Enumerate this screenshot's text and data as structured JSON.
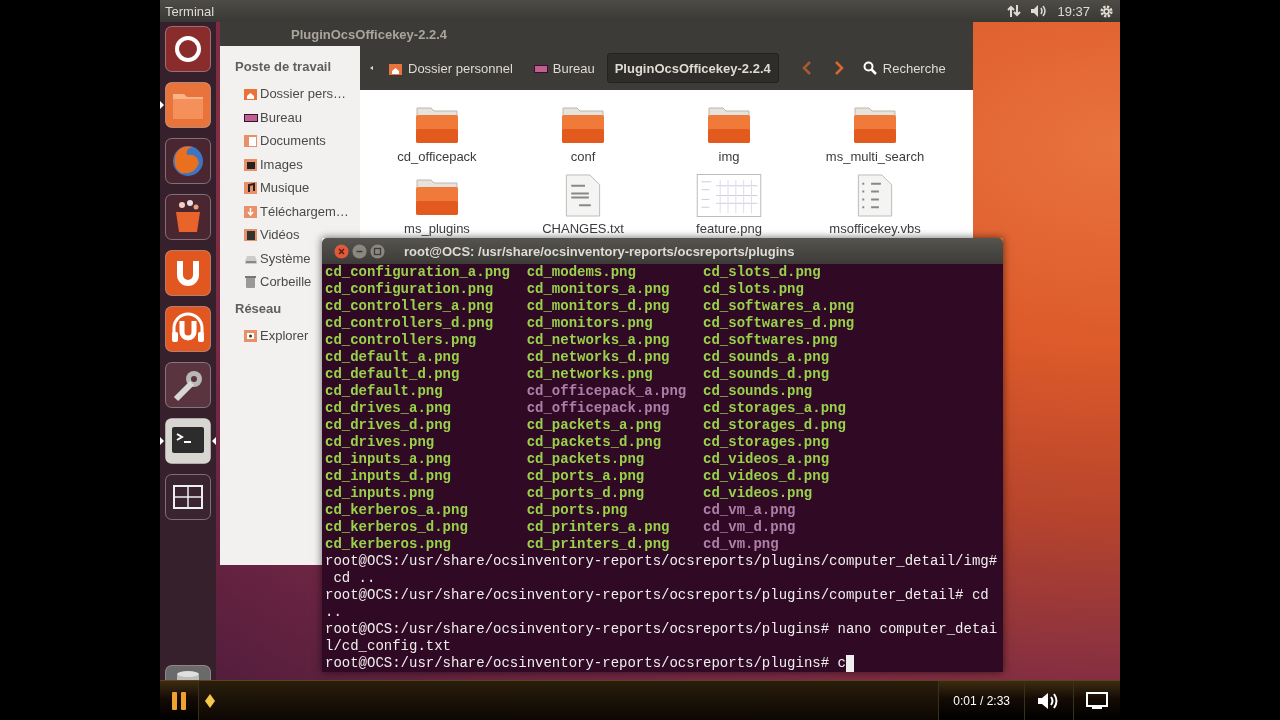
{
  "top_panel": {
    "app_title": "Terminal",
    "clock": "19:37"
  },
  "launcher": {
    "items": [
      {
        "kind": "dash",
        "running": false,
        "focused": false
      },
      {
        "kind": "files",
        "running": true,
        "focused": false
      },
      {
        "kind": "browser",
        "running": false,
        "focused": false
      },
      {
        "kind": "software_center",
        "running": false,
        "focused": false
      },
      {
        "kind": "ubuntu_one",
        "running": false,
        "focused": false
      },
      {
        "kind": "music_store",
        "running": false,
        "focused": false
      },
      {
        "kind": "settings",
        "running": false,
        "focused": false
      },
      {
        "kind": "terminal",
        "running": true,
        "focused": true
      },
      {
        "kind": "workspaces",
        "running": false,
        "focused": false
      },
      {
        "kind": "trash",
        "running": false,
        "focused": false
      }
    ]
  },
  "file_manager": {
    "title": "PluginOcsOfficekey-2.2.4",
    "sidebar": [
      {
        "heading": "Poste de travail",
        "items": [
          {
            "label": "Dossier pers…",
            "kind": "home"
          },
          {
            "label": "Bureau",
            "kind": "desktop"
          },
          {
            "label": "Documents",
            "kind": "documents"
          },
          {
            "label": "Images",
            "kind": "pictures"
          },
          {
            "label": "Musique",
            "kind": "music"
          },
          {
            "label": "Téléchargem…",
            "kind": "downloads"
          },
          {
            "label": "Vidéos",
            "kind": "videos"
          },
          {
            "label": "Système",
            "kind": "drive"
          },
          {
            "label": "Corbeille",
            "kind": "trash"
          }
        ]
      },
      {
        "heading": "Réseau",
        "items": [
          {
            "label": "Explorer",
            "kind": "network"
          }
        ]
      }
    ],
    "path_bar": {
      "crumbs": [
        {
          "label": "Dossier personnel",
          "kind": "home",
          "selected": false
        },
        {
          "label": "Bureau",
          "kind": "desktop",
          "selected": false
        },
        {
          "label": "PluginOcsOfficekey-2.2.4",
          "selected": true
        }
      ],
      "search_label": "Recherche"
    },
    "items": [
      {
        "name": "cd_officepack",
        "kind": "folder"
      },
      {
        "name": "conf",
        "kind": "folder"
      },
      {
        "name": "img",
        "kind": "folder"
      },
      {
        "name": "ms_multi_search",
        "kind": "folder"
      },
      {
        "name": "ms_plugins",
        "kind": "folder"
      },
      {
        "name": "CHANGES.txt",
        "kind": "text"
      },
      {
        "name": "feature.png",
        "kind": "image"
      },
      {
        "name": "msofficekey.vbs",
        "kind": "script"
      }
    ]
  },
  "terminal": {
    "title": "root@OCS: /usr/share/ocsinventory-reports/ocsreports/plugins",
    "listing": [
      [
        {
          "text": "cd_configuration_a.png",
          "color": "#98d24a"
        },
        {
          "text": "cd_modems.png",
          "color": "#98d24a"
        },
        {
          "text": "cd_slots_d.png",
          "color": "#98d24a"
        }
      ],
      [
        {
          "text": "cd_configuration.png",
          "color": "#98d24a"
        },
        {
          "text": "cd_monitors_a.png",
          "color": "#98d24a"
        },
        {
          "text": "cd_slots.png",
          "color": "#98d24a"
        }
      ],
      [
        {
          "text": "cd_controllers_a.png",
          "color": "#98d24a"
        },
        {
          "text": "cd_monitors_d.png",
          "color": "#98d24a"
        },
        {
          "text": "cd_softwares_a.png",
          "color": "#98d24a"
        }
      ],
      [
        {
          "text": "cd_controllers_d.png",
          "color": "#98d24a"
        },
        {
          "text": "cd_monitors.png",
          "color": "#98d24a"
        },
        {
          "text": "cd_softwares_d.png",
          "color": "#98d24a"
        }
      ],
      [
        {
          "text": "cd_controllers.png",
          "color": "#98d24a"
        },
        {
          "text": "cd_networks_a.png",
          "color": "#98d24a"
        },
        {
          "text": "cd_softwares.png",
          "color": "#98d24a"
        }
      ],
      [
        {
          "text": "cd_default_a.png",
          "color": "#98d24a"
        },
        {
          "text": "cd_networks_d.png",
          "color": "#98d24a"
        },
        {
          "text": "cd_sounds_a.png",
          "color": "#98d24a"
        }
      ],
      [
        {
          "text": "cd_default_d.png",
          "color": "#98d24a"
        },
        {
          "text": "cd_networks.png",
          "color": "#98d24a"
        },
        {
          "text": "cd_sounds_d.png",
          "color": "#98d24a"
        }
      ],
      [
        {
          "text": "cd_default.png",
          "color": "#98d24a"
        },
        {
          "text": "cd_officepack_a.png",
          "color": "#ad7fa8"
        },
        {
          "text": "cd_sounds.png",
          "color": "#98d24a"
        }
      ],
      [
        {
          "text": "cd_drives_a.png",
          "color": "#98d24a"
        },
        {
          "text": "cd_officepack.png",
          "color": "#ad7fa8"
        },
        {
          "text": "cd_storages_a.png",
          "color": "#98d24a"
        }
      ],
      [
        {
          "text": "cd_drives_d.png",
          "color": "#98d24a"
        },
        {
          "text": "cd_packets_a.png",
          "color": "#98d24a"
        },
        {
          "text": "cd_storages_d.png",
          "color": "#98d24a"
        }
      ],
      [
        {
          "text": "cd_drives.png",
          "color": "#98d24a"
        },
        {
          "text": "cd_packets_d.png",
          "color": "#98d24a"
        },
        {
          "text": "cd_storages.png",
          "color": "#98d24a"
        }
      ],
      [
        {
          "text": "cd_inputs_a.png",
          "color": "#98d24a"
        },
        {
          "text": "cd_packets.png",
          "color": "#98d24a"
        },
        {
          "text": "cd_videos_a.png",
          "color": "#98d24a"
        }
      ],
      [
        {
          "text": "cd_inputs_d.png",
          "color": "#98d24a"
        },
        {
          "text": "cd_ports_a.png",
          "color": "#98d24a"
        },
        {
          "text": "cd_videos_d.png",
          "color": "#98d24a"
        }
      ],
      [
        {
          "text": "cd_inputs.png",
          "color": "#98d24a"
        },
        {
          "text": "cd_ports_d.png",
          "color": "#98d24a"
        },
        {
          "text": "cd_videos.png",
          "color": "#98d24a"
        }
      ],
      [
        {
          "text": "cd_kerberos_a.png",
          "color": "#98d24a"
        },
        {
          "text": "cd_ports.png",
          "color": "#98d24a"
        },
        {
          "text": "cd_vm_a.png",
          "color": "#ad7fa8"
        }
      ],
      [
        {
          "text": "cd_kerberos_d.png",
          "color": "#98d24a"
        },
        {
          "text": "cd_printers_a.png",
          "color": "#98d24a"
        },
        {
          "text": "cd_vm_d.png",
          "color": "#ad7fa8"
        }
      ],
      [
        {
          "text": "cd_kerberos.png",
          "color": "#98d24a"
        },
        {
          "text": "cd_printers_d.png",
          "color": "#98d24a"
        },
        {
          "text": "cd_vm.png",
          "color": "#ad7fa8"
        }
      ]
    ],
    "output": [
      "root@OCS:/usr/share/ocsinventory-reports/ocsreports/plugins/computer_detail/img#",
      " cd ..",
      "root@OCS:/usr/share/ocsinventory-reports/ocsreports/plugins/computer_detail# cd",
      "..",
      "root@OCS:/usr/share/ocsinventory-reports/ocsreports/plugins# nano computer_detai",
      "l/cd_config.txt",
      "root@OCS:/usr/share/ocsinventory-reports/ocsreports/plugins# c"
    ],
    "cursor_visible": true
  },
  "player": {
    "playing": true,
    "level": 0.015,
    "time": "0:01 / 2:33"
  }
}
